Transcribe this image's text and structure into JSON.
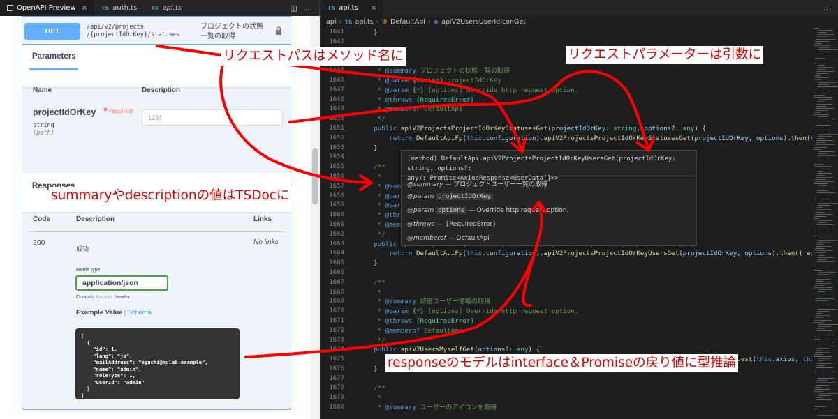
{
  "left_tabs": [
    {
      "label": "OpenAPI Preview",
      "active": true,
      "icon": "preview-icon"
    },
    {
      "label": "auth.ts",
      "active": false,
      "icon": "ts-icon"
    },
    {
      "label": "api.ts",
      "active": false,
      "icon": "ts-icon"
    }
  ],
  "ts_badge": "TS",
  "close_glyph": "×",
  "operation": {
    "method": "GET",
    "path_line1": "/api/v2/projects",
    "path_line2": "/{projectIdOrKey}/statuses",
    "summary": "プロジェクトの状態一覧の取得"
  },
  "parameters": {
    "tab_label": "Parameters",
    "col_name": "Name",
    "col_description": "Description",
    "name": "projectIdOrKey",
    "star": "*",
    "required_label": "required",
    "type": "string",
    "in": "(path)",
    "placeholder": "1234"
  },
  "responses": {
    "title": "Responses",
    "col_code": "Code",
    "col_description": "Description",
    "col_links": "Links",
    "code": "200",
    "description": "成功",
    "links": "No links",
    "media_type_label": "Media type",
    "media_type_value": "application/json",
    "controls_prefix": "Controls ",
    "controls_code": "Accept",
    "controls_suffix": " header.",
    "example_value_tab": "Example Value",
    "schema_tab": "Schema",
    "example_json": "[\n  {\n    \"id\": 1,\n    \"lang\": \"ja\",\n    \"mailAddress\": \"eguchi@nulab.example\",\n    \"name\": \"admin\",\n    \"roleType\": 1,\n    \"userId\": \"admin\"\n  }\n]"
  },
  "editor": {
    "tab_label": "api.ts",
    "breadcrumb": [
      "api",
      "api.ts",
      "DefaultApi",
      "apiV2UsersUserIdIconGet"
    ],
    "line_numbers": [
      1641,
      1642,
      1643,
      1644,
      1645,
      1646,
      1647,
      1648,
      1649,
      1650,
      1651,
      1652,
      1653,
      1654,
      1655,
      1656,
      1657,
      1658,
      1659,
      1660,
      1661,
      1662,
      1663,
      1664,
      1665,
      1666,
      1667,
      1668,
      1669,
      1670,
      1671,
      1672,
      1673,
      1674,
      1675,
      1676,
      1677,
      1678,
      1679,
      1680
    ],
    "code_lines": [
      "    }",
      "",
      "",
      "    /**",
      "     * @summary プロジェクトの状態一覧の取得",
      "     * @param {string} projectIdOrKey",
      "     * @param {*} [options] Override http request option.",
      "     * @throws {RequiredError}",
      "     * @memberof DefaultApi",
      "     */",
      "    public apiV2ProjectsProjectIdOrKeyStatusesGet(projectIdOrKey: string, options?: any) {",
      "        return DefaultApiFp(this.configuration).apiV2ProjectsProjectIdOrKeyStatusesGet(projectIdOrKey, options).then((req",
      "    }",
      "",
      "    /**",
      "     *",
      "     * @summary",
      "     * @param",
      "     * @param",
      "     * @throws",
      "     * @memberof",
      "     */",
      "    public apiV2ProjectsProjectIdOrKeyUsersGet(projectIdOrKey: string, options?: any) {",
      "        return DefaultApiFp(this.configuration).apiV2ProjectsProjectIdOrKeyUsersGet(projectIdOrKey, options).then((reque",
      "    }",
      "",
      "    /**",
      "     *",
      "     * @summary 認証ユーザー情報の取得",
      "     * @param {*} [options] Override http request option.",
      "     * @throws {RequiredError}",
      "     * @memberof DefaultApi",
      "     */",
      "    public apiV2UsersMyselfGet(options?: any) {",
      "        return DefaultApiFp(this.configuration).apiV2UsersMyselfGet(options).then((request) => request(this.axios, this",
      "    }",
      "",
      "    /**",
      "     *",
      "     * @summary ユーザーのアイコンを取得"
    ]
  },
  "hover": {
    "signature_line1": "(method) DefaultApi.apiV2ProjectsProjectIdOrKeyUsersGet(projectIdOrKey: string, options?:",
    "signature_line2": "any): Promise<AxiosResponse<UserData[]>>",
    "summary_tag": "@summary",
    "summary_text": " — プロジェクトユーザー一覧の取得",
    "param1_tag": "@param",
    "param1_name": "projectIdOrKey",
    "param2_tag": "@param",
    "param2_name": "options",
    "param2_text": " — Override http request option.",
    "throws_tag": "@throws",
    "throws_text": " — {RequiredError}",
    "memberof_tag": "@memberof",
    "memberof_text": " — DefaultApi"
  },
  "annotations": {
    "path_to_method": "リクエストパスはメソッド名に",
    "params_to_args": "リクエストパラメーターは引数に",
    "summary_to_tsdoc": "summaryやdescriptionの値はTSDocに",
    "response_to_type": "responseのモデルはinterface＆Promiseの戻り値に型推論"
  },
  "colors": {
    "get_blue": "#61affe",
    "annotation_red": "#e10000",
    "media_green": "#41a540",
    "editor_bg": "#1e1e1e"
  }
}
